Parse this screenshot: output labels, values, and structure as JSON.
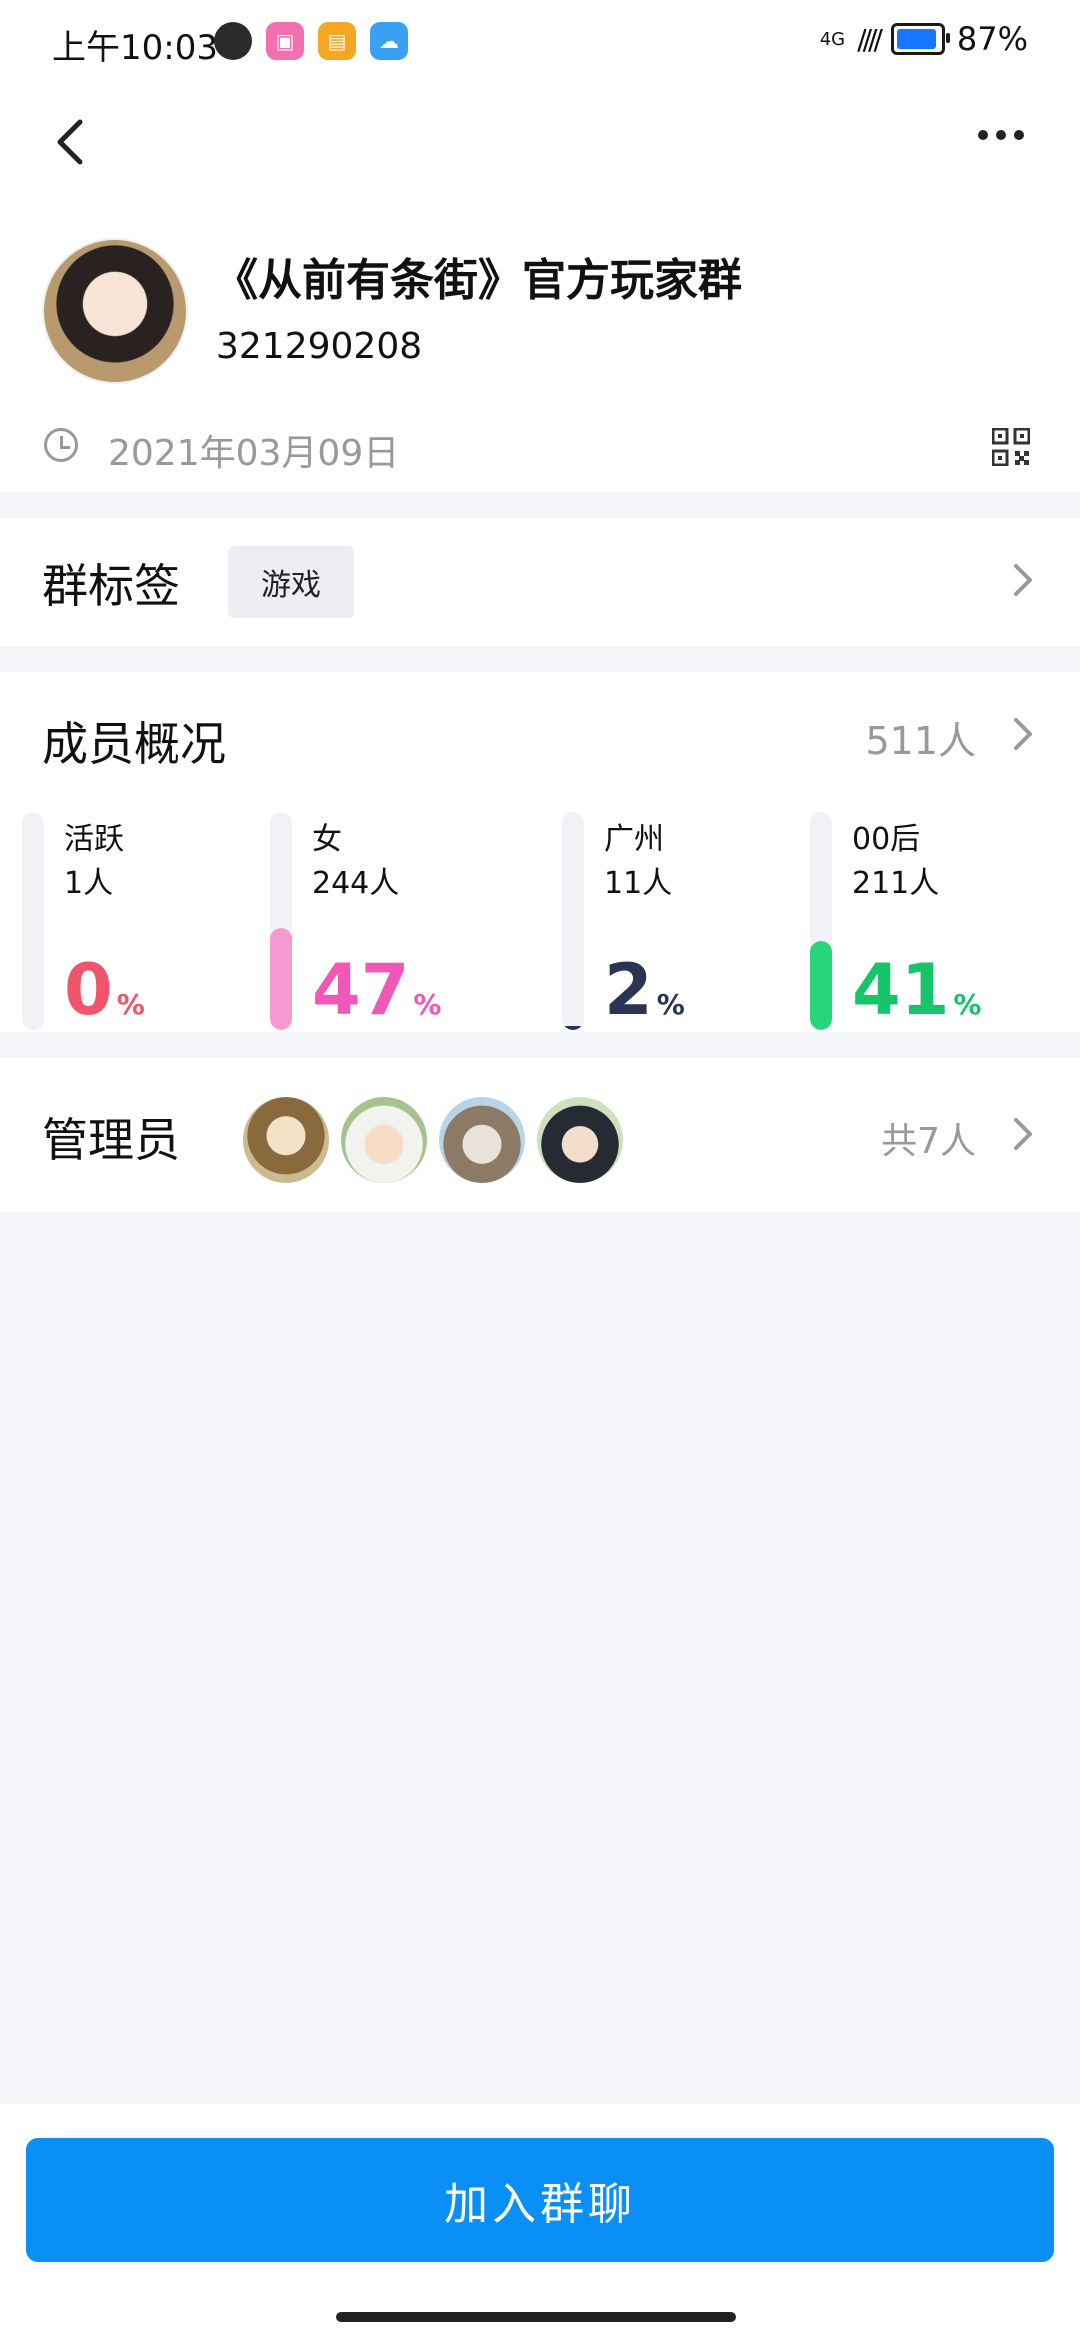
{
  "status_bar": {
    "time": "上午10:03",
    "network": "4G",
    "battery": "87%",
    "battery_level": 0.87
  },
  "header": {
    "back_icon": "chevron-left-icon",
    "more_icon": "more-horizontal-icon"
  },
  "group": {
    "name": "《从前有条街》官方玩家群",
    "id": "321290208",
    "date": "2021年03月09日"
  },
  "tags": {
    "title": "群标签",
    "items": [
      "游戏"
    ]
  },
  "members": {
    "title": "成员概况",
    "count": "511人",
    "stats": [
      {
        "label": "活跃",
        "count": "1人",
        "percent": "0",
        "unit": "%",
        "value": 0,
        "color": "#f2556b",
        "fill": "#f2556b"
      },
      {
        "label": "女",
        "count": "244人",
        "percent": "47",
        "unit": "%",
        "value": 47,
        "color": "#f157b6",
        "fill": "#f79ad2"
      },
      {
        "label": "广州",
        "count": "11人",
        "percent": "2",
        "unit": "%",
        "value": 2,
        "color": "#2b3452",
        "fill": "#2b3452"
      },
      {
        "label": "00后",
        "count": "211人",
        "percent": "41",
        "unit": "%",
        "value": 41,
        "color": "#16c46a",
        "fill": "#29d57b"
      }
    ]
  },
  "admins": {
    "title": "管理员",
    "total": "共7人"
  },
  "actions": {
    "join": "加入群聊"
  }
}
